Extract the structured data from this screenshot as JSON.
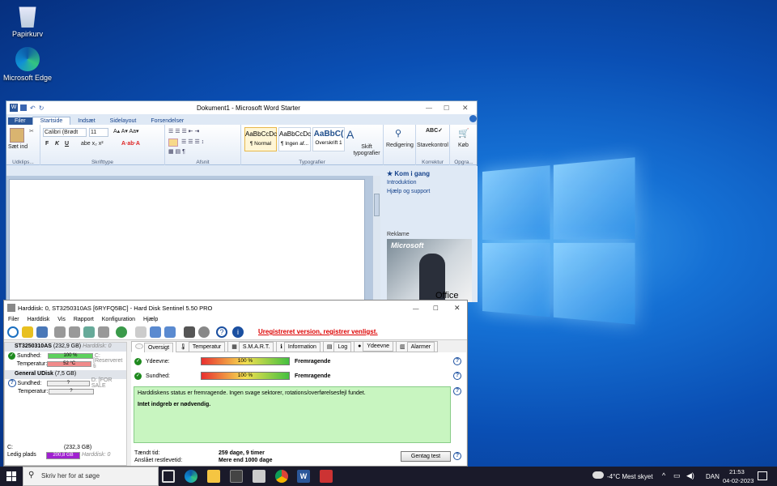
{
  "desktop": {
    "icons": [
      {
        "label": "Papirkurv"
      },
      {
        "label": "Microsoft Edge"
      }
    ]
  },
  "word": {
    "title": "Dokument1 - Microsoft Word Starter",
    "tabs": [
      "Filer",
      "Startside",
      "Indsæt",
      "Sidelayout",
      "Forsendelser"
    ],
    "clipboard": {
      "paste": "Sæt ind",
      "label": "Udklips..."
    },
    "font": {
      "name": "Calibri (Brødt",
      "size": "11",
      "label": "Skrifttype"
    },
    "paragraph_label": "Afsnit",
    "styles": [
      {
        "sample": "AaBbCcDc",
        "name": "¶ Normal"
      },
      {
        "sample": "AaBbCcDc",
        "name": "¶ Ingen af..."
      },
      {
        "sample": "AaBbC(",
        "name": "Overskrift 1"
      }
    ],
    "change_styles": "Skift typografier",
    "styles_label": "Typografier",
    "editing": "Redigering",
    "proofing": {
      "button": "Stavekontrol",
      "label": "Korrektur"
    },
    "buy": {
      "button": "Køb",
      "label": "Opgra..."
    },
    "side": {
      "heading": "Kom i gang",
      "links": [
        "Introduktion",
        "Hjælp og support"
      ],
      "ad_label": "Reklame",
      "ad_brand": "Microsoft",
      "ad_product": "Office"
    }
  },
  "hds": {
    "title": "Harddisk: 0, ST3250310AS [6RYFQ5BC] - Hard Disk Sentinel 5.50 PRO",
    "menu": [
      "Filer",
      "Harddisk",
      "Vis",
      "Rapport",
      "Konfiguration",
      "Hjælp"
    ],
    "unregistered": "Uregistreret version, registrer venligst.",
    "tabs": [
      "Oversigt",
      "Temperatur",
      "S.M.A.R.T.",
      "Information",
      "Log",
      "Ydeevne",
      "Alarmer"
    ],
    "drives": [
      {
        "name": "ST3250310AS",
        "size": "(232,9 GB)",
        "disk": "Harddisk: 0",
        "health_label": "Sundhed:",
        "health": "100 %",
        "health_extra": "C:",
        "temp_label": "Temperatur:",
        "temp": "52 °C",
        "temp_extra": "[Reserveret ti"
      },
      {
        "name": "General UDisk",
        "size": "(7,5 GB)",
        "health_label": "Sundhed:",
        "health": "?",
        "health_extra": "D: [FOR SALE",
        "temp_label": "Temperatur:",
        "temp": "?"
      }
    ],
    "volume": {
      "letter": "C:",
      "size": "(232,3 GB)",
      "free_label": "Ledig plads",
      "free": "200,8 GB",
      "disk": "Harddisk: 0"
    },
    "overview": {
      "perf_label": "Ydeevne:",
      "perf": "100 %",
      "perf_status": "Fremragende",
      "health_label": "Sundhed:",
      "health": "100 %",
      "health_status": "Fremragende",
      "message": "Harddiskens status er fremragende. Ingen svage sektorer, rotations/overførelsesfejl fundet.",
      "action": "Intet indgreb er nødvendig.",
      "power_on_label": "Tændt tid:",
      "power_on": "259 dage, 9 timer",
      "remaining_label": "Anslået restlevetid:",
      "remaining": "Mere end 1000 dage",
      "retry_button": "Gentag test"
    }
  },
  "taskbar": {
    "search_placeholder": "Skriv her for at søge",
    "weather": "-4°C  Mest skyet",
    "language": "DAN",
    "time": "21:53",
    "date": "04-02-2023"
  },
  "colors": {
    "desktop": "#0a4fb4",
    "ribbon_file": "#2b579a",
    "hds_green": "#c8f5c0"
  }
}
